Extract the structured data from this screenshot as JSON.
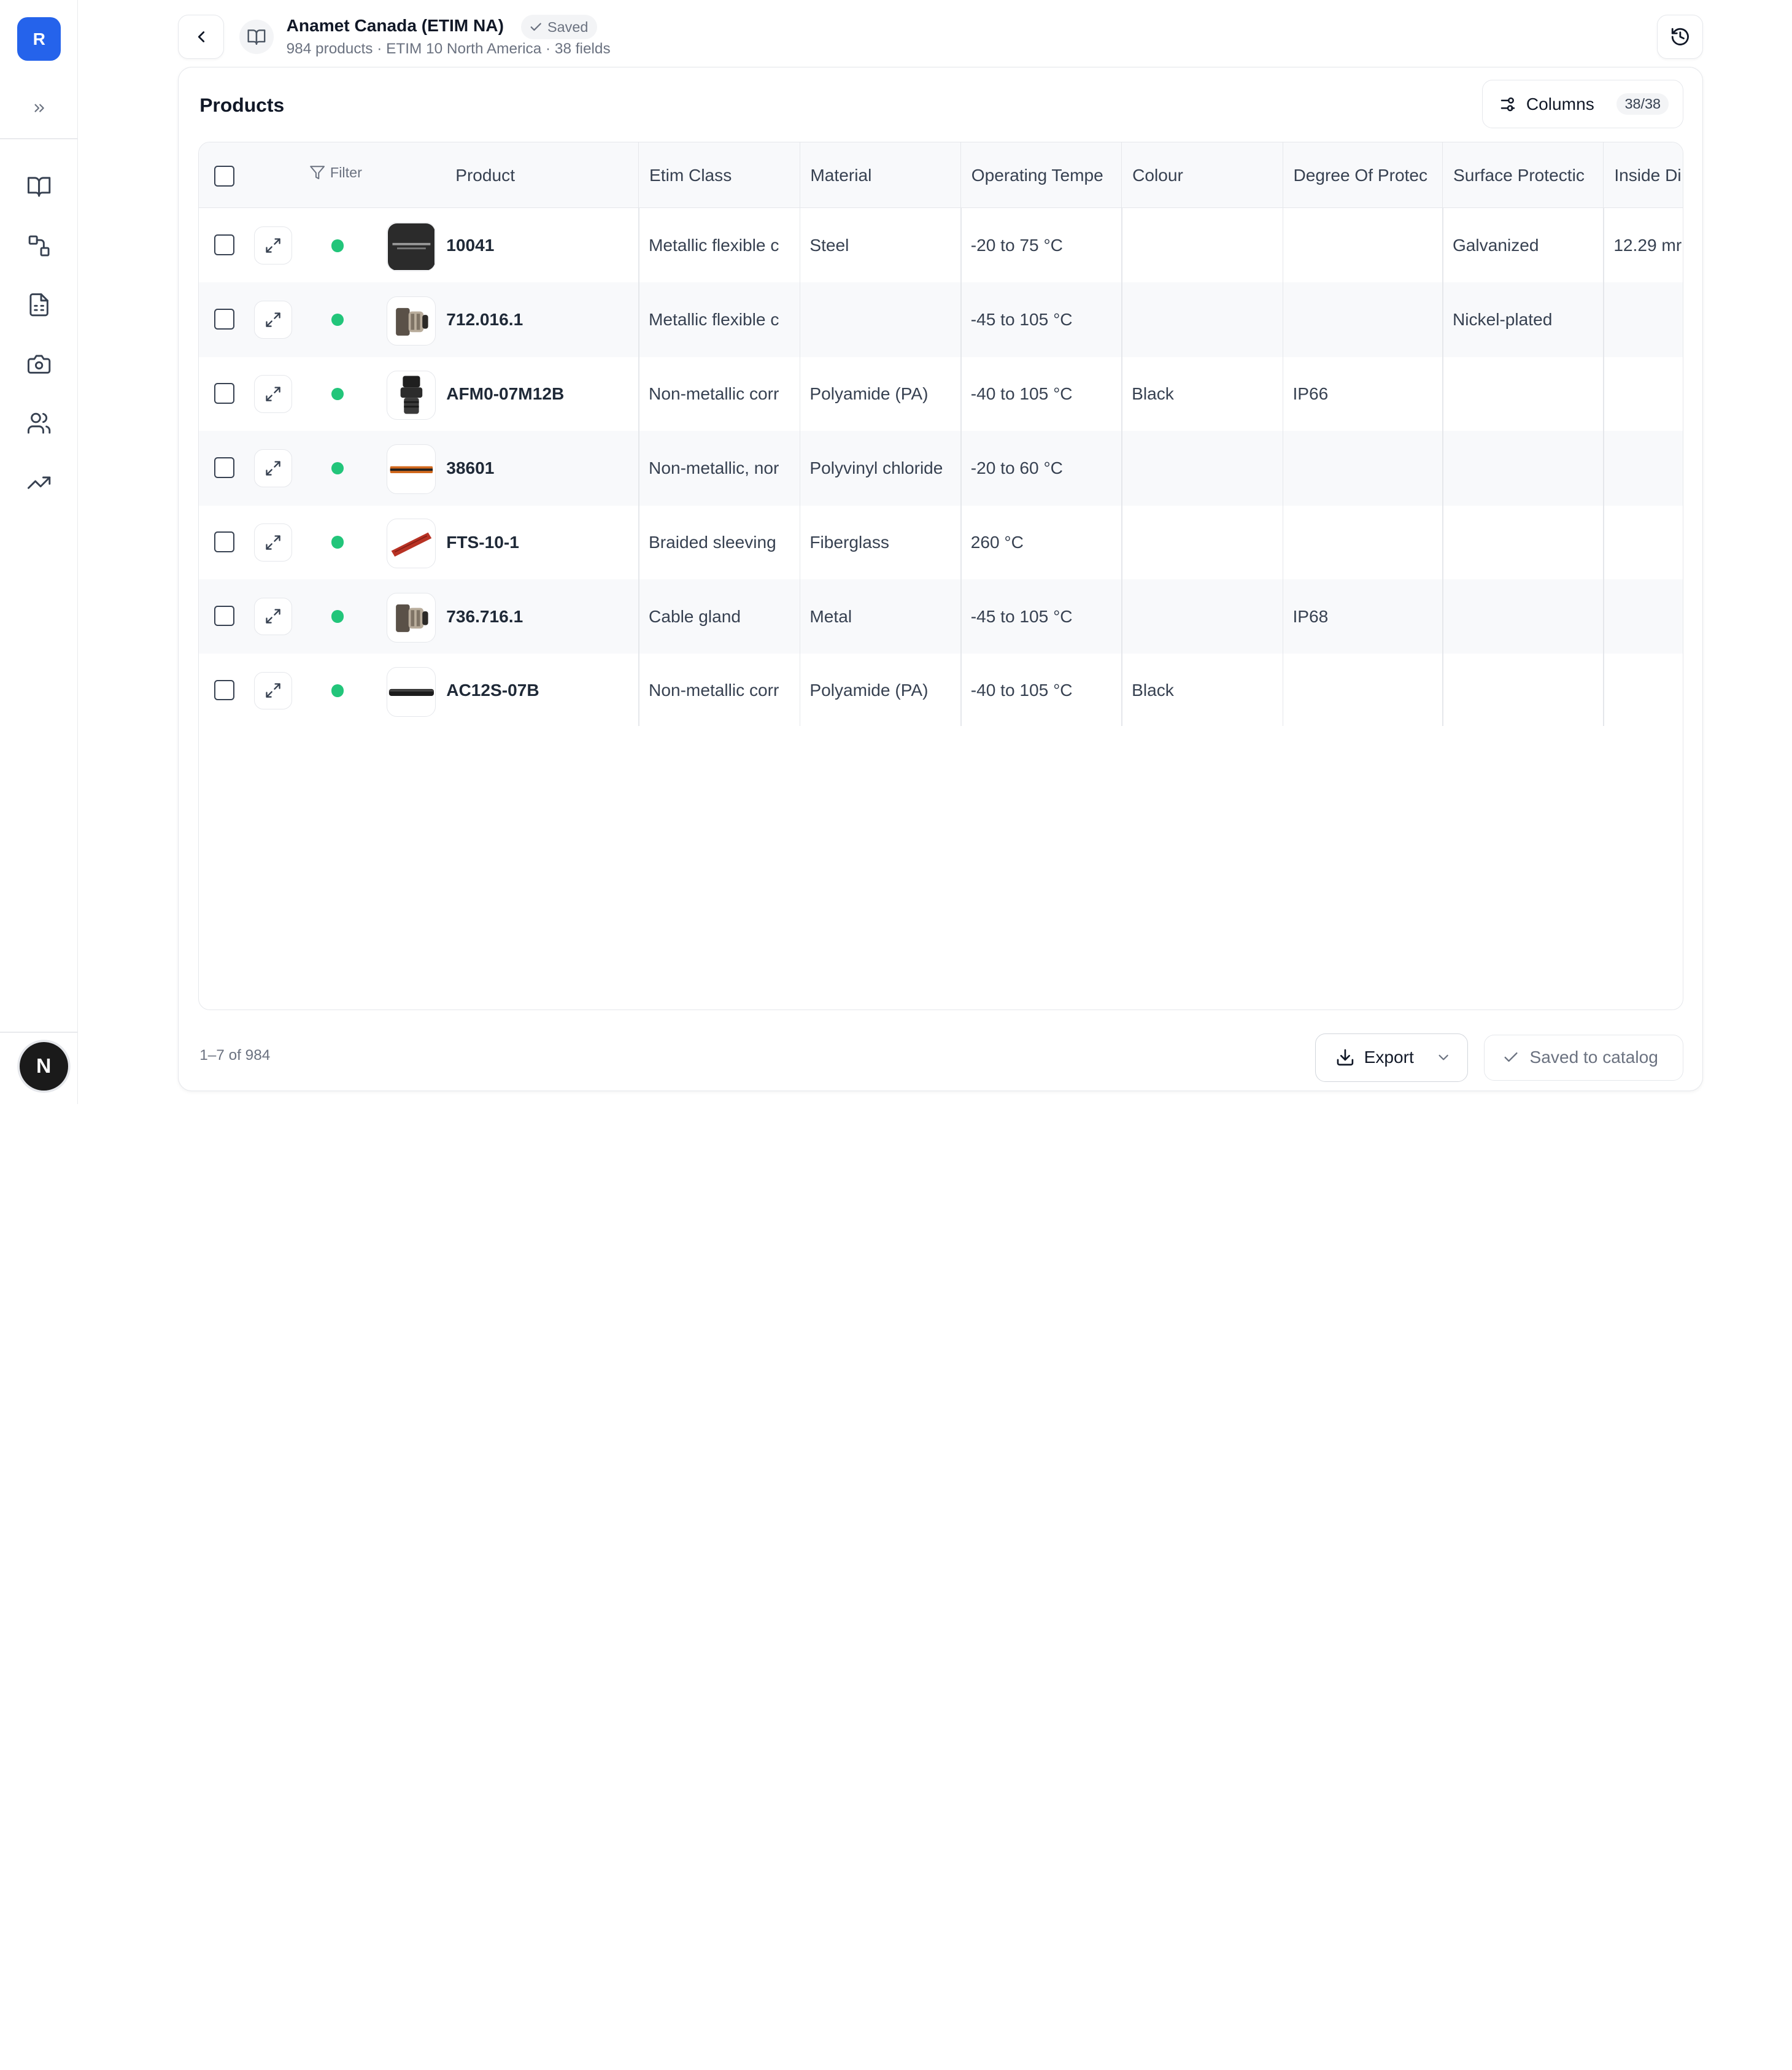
{
  "sidebar": {
    "logo_letter": "R",
    "expand_glyph": "»",
    "nav_items": [
      {
        "icon": "book-icon"
      },
      {
        "icon": "shapes-icon"
      },
      {
        "icon": "spreadsheet-icon"
      },
      {
        "icon": "camera-icon"
      },
      {
        "icon": "users-icon"
      },
      {
        "icon": "trending-up-icon"
      }
    ],
    "avatar_letter": "N"
  },
  "header": {
    "title": "Anamet Canada (ETIM NA)",
    "saved_badge": "Saved",
    "subtitle": "984 products · ETIM 10 North America · 38 fields"
  },
  "card": {
    "title": "Products",
    "columns_label": "Columns",
    "columns_count": "38/38"
  },
  "table": {
    "filter_label": "Filter",
    "headers": [
      "Product",
      "Etim Class",
      "Material",
      "Operating Tempe",
      "Colour",
      "Degree Of Protec",
      "Surface Protectic",
      "Inside Di"
    ],
    "rows": [
      {
        "product": "10041",
        "etim_class": "Metallic flexible c",
        "material": "Steel",
        "temp": "-20 to 75 °C",
        "colour": "",
        "protection": "",
        "surface": "Galvanized",
        "inside": "12.29 mr",
        "status": "active",
        "thumb": "black-label"
      },
      {
        "product": "712.016.1",
        "etim_class": "Metallic flexible c",
        "material": "",
        "temp": "-45 to 105 °C",
        "colour": "",
        "protection": "",
        "surface": "Nickel-plated",
        "inside": "",
        "status": "active",
        "thumb": "metal-gland"
      },
      {
        "product": "AFM0-07M12B",
        "etim_class": "Non-metallic corr",
        "material": "Polyamide (PA)",
        "temp": "-40 to 105 °C",
        "colour": "Black",
        "protection": "IP66",
        "surface": "",
        "inside": "",
        "status": "active",
        "thumb": "black-fitting"
      },
      {
        "product": "38601",
        "etim_class": "Non-metallic, nor",
        "material": "Polyvinyl chloride",
        "temp": "-20 to 60 °C",
        "colour": "",
        "protection": "",
        "surface": "",
        "inside": "",
        "status": "active",
        "thumb": "orange-tube"
      },
      {
        "product": "FTS-10-1",
        "etim_class": "Braided sleeving",
        "material": "Fiberglass",
        "temp": "260 °C",
        "colour": "",
        "protection": "",
        "surface": "",
        "inside": "",
        "status": "active",
        "thumb": "red-sleeve"
      },
      {
        "product": "736.716.1",
        "etim_class": "Cable gland",
        "material": "Metal",
        "temp": "-45 to 105 °C",
        "colour": "",
        "protection": "IP68",
        "surface": "",
        "inside": "",
        "status": "active",
        "thumb": "metal-gland"
      },
      {
        "product": "AC12S-07B",
        "etim_class": "Non-metallic corr",
        "material": "Polyamide (PA)",
        "temp": "-40 to 105 °C",
        "colour": "Black",
        "protection": "",
        "surface": "",
        "inside": "",
        "status": "active",
        "thumb": "black-tube"
      }
    ]
  },
  "footer": {
    "count": "1–7 of 984",
    "export_label": "Export",
    "saved_catalog_label": "Saved to catalog"
  },
  "colors": {
    "accent": "#2563eb",
    "status_active": "#22c57a",
    "border": "#e5e7eb"
  }
}
